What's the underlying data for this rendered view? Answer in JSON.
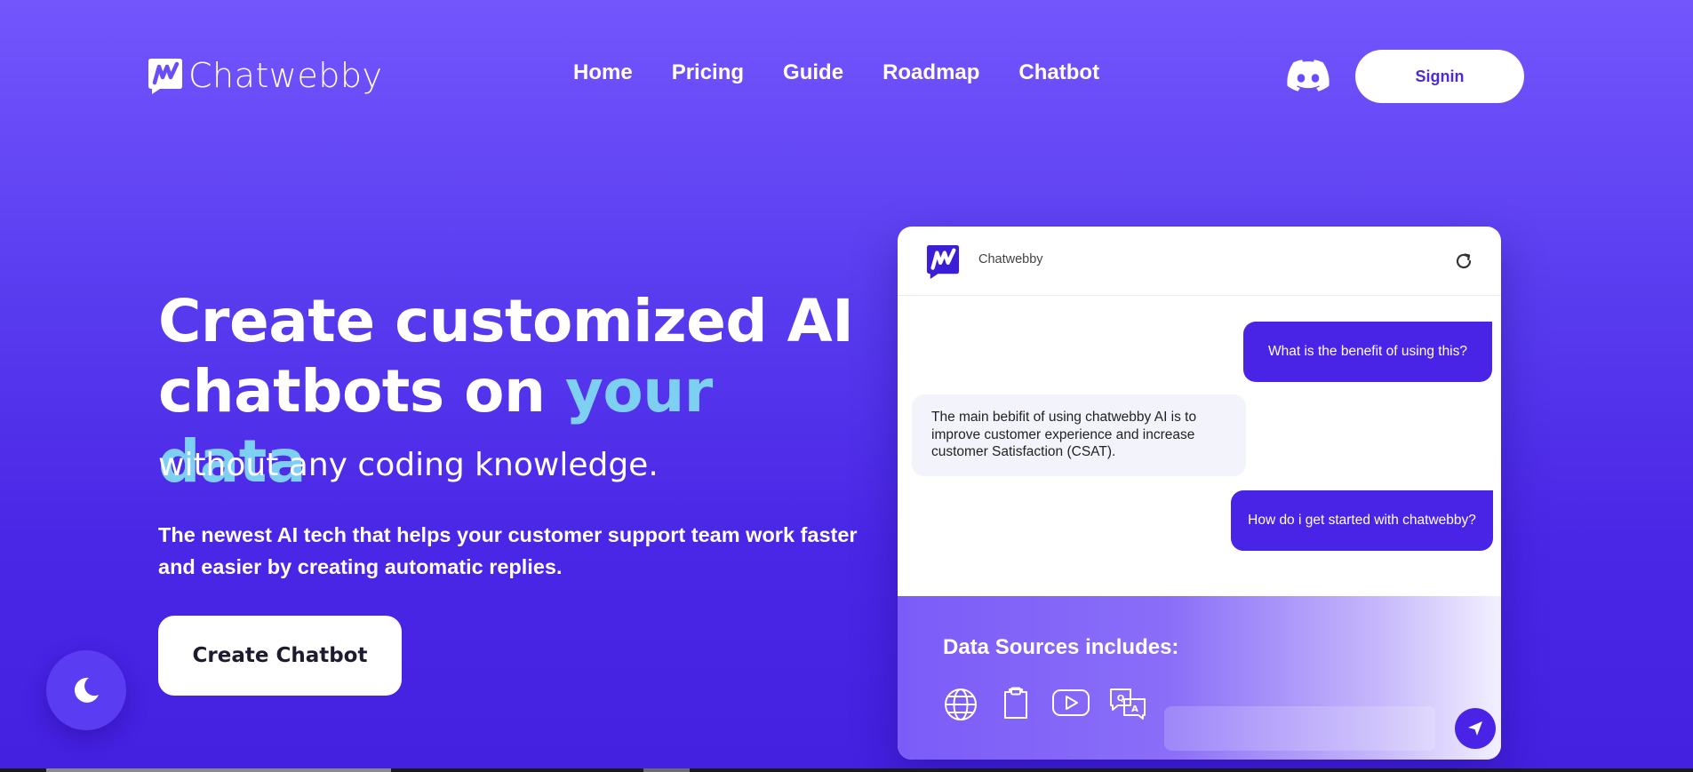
{
  "header": {
    "brand": "Chatwebby",
    "nav": [
      "Home",
      "Pricing",
      "Guide",
      "Roadmap",
      "Chatbot"
    ],
    "discord_icon": "discord-icon",
    "signin_label": "Signin"
  },
  "hero": {
    "title_line1": "Create customized AI",
    "title_line2_plain": "chatbots on ",
    "title_line2_accent": "your data",
    "subtitle": "without any coding knowledge.",
    "description": "The newest AI tech that helps your customer support team work faster and easier by creating automatic replies.",
    "cta_label": "Create Chatbot"
  },
  "theme_toggle_icon": "moon-icon",
  "widget": {
    "title": "Chatwebby",
    "refresh_icon": "refresh-icon",
    "messages": [
      {
        "role": "user",
        "text": "What is the benefit of using this?"
      },
      {
        "role": "bot",
        "text": "The main bebifit of using chatwebby AI is to improve customer experience and increase customer Satisfaction (CSAT)."
      },
      {
        "role": "user",
        "text": "How do i get started with chatwebby?"
      }
    ],
    "sources_title": "Data Sources includes:",
    "source_icons": [
      "globe-icon",
      "document-icon",
      "video-play-icon",
      "qa-translate-icon"
    ],
    "input_value": "",
    "send_icon": "send-icon"
  },
  "colors": {
    "background_top": "#7456fd",
    "background_bottom": "#4420e0",
    "accent_text": "#7ed0f2",
    "user_bubble": "#4a24e6",
    "bot_bubble": "#f3f4fb"
  }
}
